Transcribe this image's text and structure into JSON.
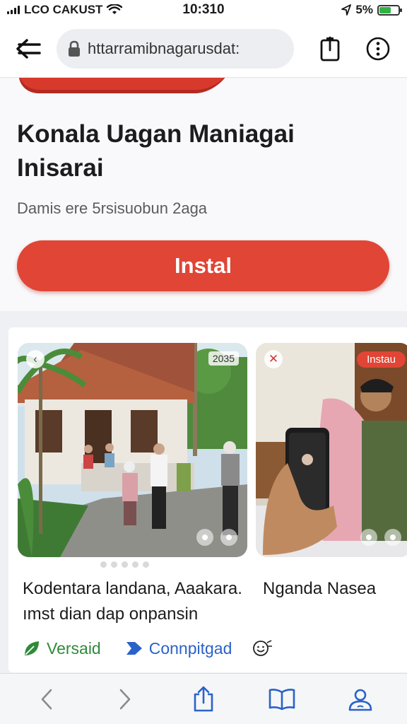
{
  "status_bar": {
    "carrier": "LCO CAKUST",
    "time": "10:310",
    "battery": "5%",
    "battery_level": 0.6
  },
  "browser": {
    "url": "httarramibnagarusdat:",
    "icons": [
      "back-arrow-icon",
      "lock-icon",
      "share-icon",
      "more-icon"
    ]
  },
  "app": {
    "title": "Konala Uagan Maniagai Inisarai",
    "subtitle": "Damis ere 5rsisuobun 2aga",
    "install_label": "Instal"
  },
  "gallery": {
    "items": [
      {
        "tag": "2035",
        "caption": "Kodentara landana, Aaakara. ımst dian dap onpansin"
      },
      {
        "badge": "Instau",
        "caption": "Nganda Nasea"
      }
    ],
    "page_count": 5
  },
  "tags": [
    {
      "label": "Versaid",
      "icon": "leaf-icon",
      "color": "#2f8a3a"
    },
    {
      "label": "Connpitgad",
      "icon": "arrow-badge-icon",
      "color": "#2a62c8"
    },
    {
      "icon": "smile-icon"
    }
  ],
  "toolbar": {
    "icons": [
      "back-icon",
      "forward-icon",
      "share-icon",
      "bookmarks-icon",
      "account-icon"
    ]
  }
}
